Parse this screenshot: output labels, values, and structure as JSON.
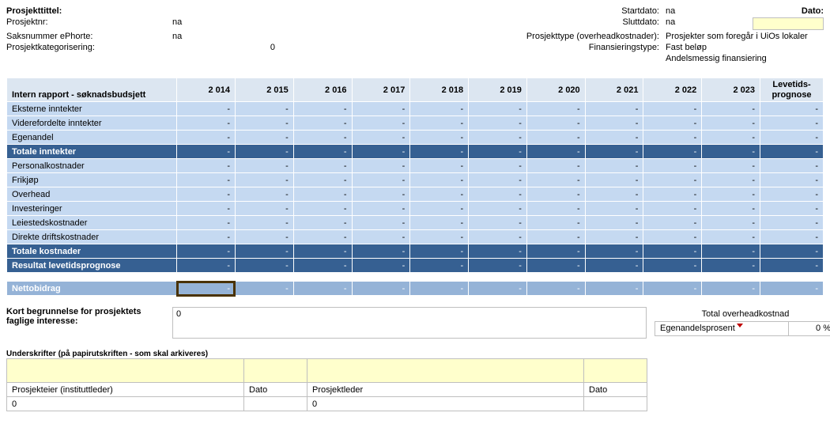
{
  "header": {
    "left": [
      {
        "label": "Prosjekttittel:",
        "value": "",
        "bold": true
      },
      {
        "label": "Prosjektnr:",
        "value": "na"
      },
      {
        "label": "Saksnummer ePhorte:",
        "value": "na"
      },
      {
        "label": "Prosjektkategorisering:",
        "value": "0"
      }
    ],
    "right": [
      {
        "label": "Startdato:",
        "value": "na"
      },
      {
        "label": "Sluttdato:",
        "value": "na"
      },
      {
        "label": "Prosjekttype (overheadkostnader):",
        "value": "Prosjekter som foregår i UiOs lokaler"
      },
      {
        "label": "Finansieringstype:",
        "value": "Fast beløp"
      },
      {
        "label": "",
        "value": "Andelsmessig finansiering"
      }
    ],
    "dato_label": "Dato:"
  },
  "budget": {
    "title": "Intern rapport - søknadsbudsjett",
    "years": [
      "2 014",
      "2 015",
      "2 016",
      "2 017",
      "2 018",
      "2 019",
      "2 020",
      "2 021",
      "2 022",
      "2 023"
    ],
    "prognose_label_l1": "Levetids-",
    "prognose_label_l2": "prognose",
    "rows": [
      {
        "label": "Eksterne inntekter",
        "style": "light"
      },
      {
        "label": "Viderefordelte inntekter",
        "style": "light"
      },
      {
        "label": "Egenandel",
        "style": "light"
      },
      {
        "label": "Totale inntekter",
        "style": "dark"
      },
      {
        "label": "Personalkostnader",
        "style": "light"
      },
      {
        "label": "Frikjøp",
        "style": "light"
      },
      {
        "label": "Overhead",
        "style": "light"
      },
      {
        "label": "Investeringer",
        "style": "light"
      },
      {
        "label": "Leiestedskostnader",
        "style": "light"
      },
      {
        "label": "Direkte driftskostnader",
        "style": "light"
      },
      {
        "label": "Totale kostnader",
        "style": "dark"
      },
      {
        "label": "Resultat levetidsprognose",
        "style": "dark"
      }
    ],
    "netto_row": {
      "label": "Nettobidrag",
      "style": "med"
    },
    "dash": "-"
  },
  "justification": {
    "label_l1": "Kort begrunnelse for prosjektets",
    "label_l2": "faglige interesse:",
    "value": "0"
  },
  "tohk": {
    "header": "Total overheadkostnad",
    "row_label": "Egenandelsprosent",
    "row_value": "0 %"
  },
  "signatures": {
    "title": "Underskrifter (på papirutskriften - som skal arkiveres)",
    "cols": [
      "Prosjekteier (instituttleder)",
      "Dato",
      "Prosjektleder",
      "Dato"
    ],
    "vals": [
      "0",
      "",
      "0",
      ""
    ]
  }
}
